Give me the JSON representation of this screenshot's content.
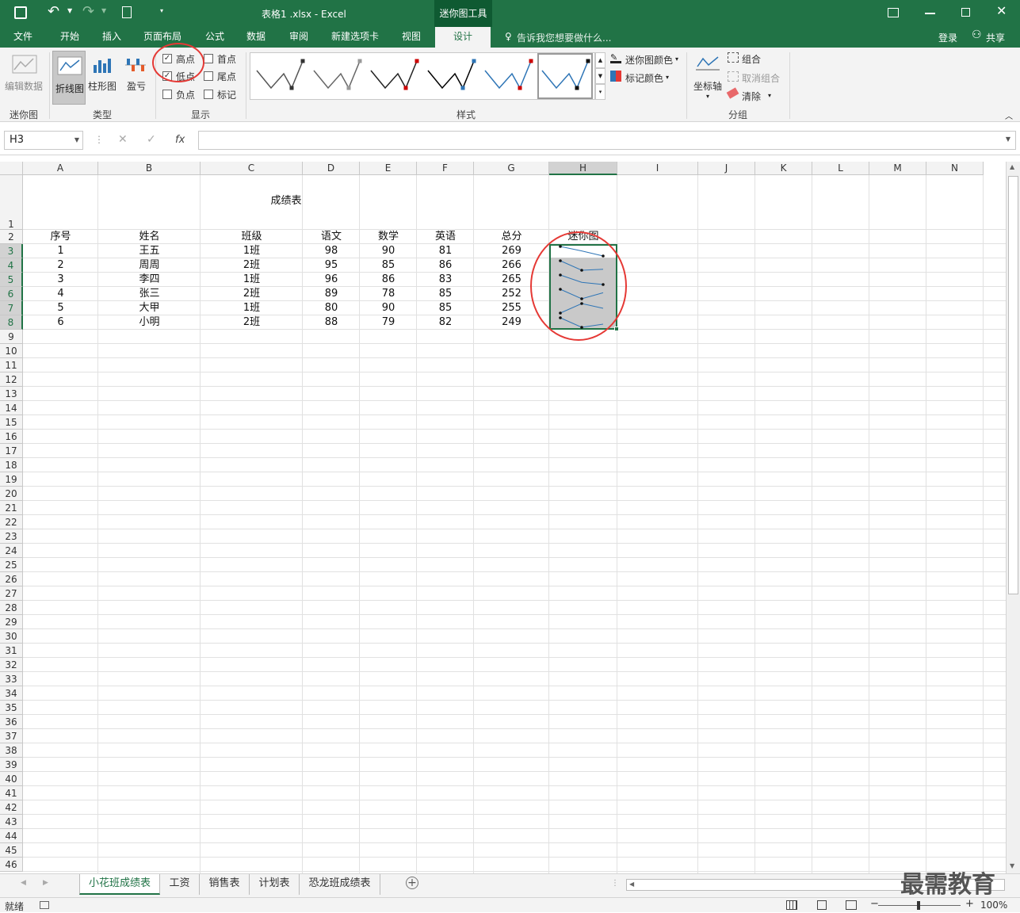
{
  "window": {
    "title": "表格1 .xlsx - Excel",
    "context_tab": "迷你图工具",
    "login": "登录",
    "share": "共享"
  },
  "tabs": [
    "文件",
    "开始",
    "插入",
    "页面布局",
    "公式",
    "数据",
    "审阅",
    "新建选项卡",
    "视图",
    "设计"
  ],
  "tell_me": "告诉我您想要做什么...",
  "ribbon": {
    "edit_data": "编辑数据",
    "sparkline_group": "迷你图",
    "type_group": "类型",
    "types": [
      "折线图",
      "柱形图",
      "盈亏"
    ],
    "show_group": "显示",
    "show": {
      "high": "高点",
      "low": "低点",
      "negative": "负点",
      "first": "首点",
      "last": "尾点",
      "markers": "标记"
    },
    "show_checked": {
      "high": true,
      "low": true,
      "negative": false,
      "first": false,
      "last": false,
      "markers": false
    },
    "style_group": "样式",
    "sparkline_color": "迷你图颜色",
    "marker_color": "标记颜色",
    "axis": "坐标轴",
    "group_btn": "组合",
    "ungroup": "取消组合",
    "clear": "清除",
    "group_group": "分组"
  },
  "formula": {
    "namebox": "H3",
    "fx": "fx",
    "value": ""
  },
  "columns": [
    "A",
    "B",
    "C",
    "D",
    "E",
    "F",
    "G",
    "H",
    "I",
    "J",
    "K",
    "L",
    "M",
    "N"
  ],
  "sheet": {
    "title": "成绩表",
    "headers": [
      "序号",
      "姓名",
      "班级",
      "语文",
      "数学",
      "英语",
      "总分",
      "迷你图"
    ],
    "rows": [
      [
        "1",
        "王五",
        "1班",
        "98",
        "90",
        "81",
        "269"
      ],
      [
        "2",
        "周周",
        "2班",
        "95",
        "85",
        "86",
        "266"
      ],
      [
        "3",
        "李四",
        "1班",
        "96",
        "86",
        "83",
        "265"
      ],
      [
        "4",
        "张三",
        "2班",
        "89",
        "78",
        "85",
        "252"
      ],
      [
        "5",
        "大甲",
        "1班",
        "80",
        "90",
        "85",
        "255"
      ],
      [
        "6",
        "小明",
        "2班",
        "88",
        "79",
        "82",
        "249"
      ]
    ]
  },
  "sheet_tabs": [
    "小花班成绩表",
    "工资",
    "销售表",
    "计划表",
    "恐龙班成绩表"
  ],
  "status": {
    "ready": "就绪",
    "zoom": "100%"
  },
  "watermark": "最需教育",
  "colors": {
    "excel_green": "#217346",
    "sparkline": "#2e75b6",
    "annotation": "#e53935"
  }
}
